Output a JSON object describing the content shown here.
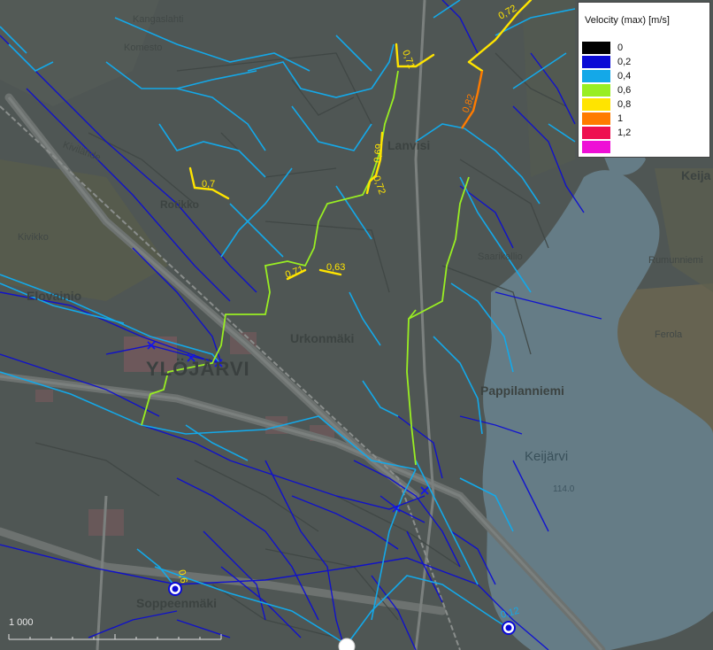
{
  "legend": {
    "title": "Velocity (max) [m/s]",
    "items": [
      {
        "label": "0",
        "color": "#000000"
      },
      {
        "label": "0,2",
        "color": "#0a0ad6"
      },
      {
        "label": "0,4",
        "color": "#14a8e8"
      },
      {
        "label": "0,6",
        "color": "#99ee22"
      },
      {
        "label": "0,8",
        "color": "#ffe400"
      },
      {
        "label": "1",
        "color": "#ff7b00"
      },
      {
        "label": "1,2",
        "color": "#ee1050"
      },
      {
        "label": "",
        "color": "#ee10d6"
      }
    ]
  },
  "places": {
    "ylojarvi": "YLÖJÄRVI",
    "soppeenmaki": "Soppeenmäki",
    "urkonmaki": "Urkonmäki",
    "pappilanniemi": "Pappilanniemi",
    "keijarvi": "Keijärvi",
    "keijarvi_level": "114.0",
    "elovainio": "Elovainio",
    "rotikko": "Rotikko",
    "kivikko": "Kivikko",
    "kivilahde": "Kivilähde",
    "kangaslahti": "Kangaslahti",
    "komesto": "Komesto",
    "ferola": "Ferola",
    "keija": "Keija",
    "ramunniemi": "Rumunniemi",
    "saarikallio": "Saarikallio",
    "lanvisi": "Lanvisi"
  },
  "velocity_labels": [
    {
      "text": "0,71"
    },
    {
      "text": "0,72"
    },
    {
      "text": "0,82"
    },
    {
      "text": "0,69"
    },
    {
      "text": "0,72"
    },
    {
      "text": "0,7"
    },
    {
      "text": "0,71"
    },
    {
      "text": "0,63"
    },
    {
      "text": "0,6"
    },
    {
      "text": "0,12"
    }
  ],
  "colors": {
    "low": "#0a0ad6",
    "medium": "#14a8e8",
    "high": "#99ee22",
    "peak": "#ffe400",
    "orange": "#ff7b00"
  },
  "scale": {
    "label": "1 000"
  }
}
